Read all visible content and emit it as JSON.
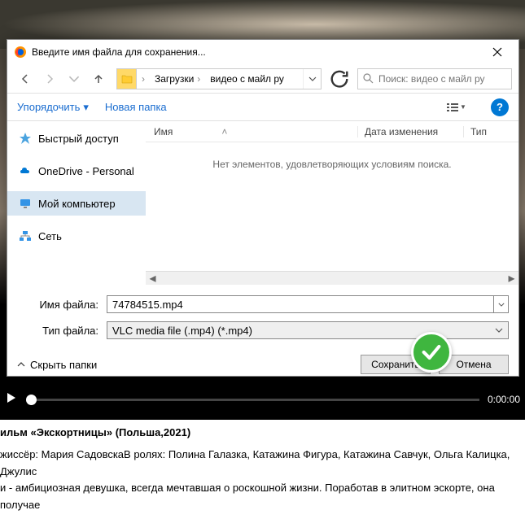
{
  "dialog": {
    "title": "Введите имя файла для сохранения...",
    "breadcrumb": {
      "seg1": "Загрузки",
      "seg2": "видео с майл ру"
    },
    "search_placeholder": "Поиск: видео с майл ру",
    "toolbar": {
      "organize": "Упорядочить",
      "new_folder": "Новая папка"
    },
    "sidebar": {
      "quick": "Быстрый доступ",
      "onedrive": "OneDrive - Personal",
      "computer": "Мой компьютер",
      "network": "Сеть"
    },
    "columns": {
      "name": "Имя",
      "date": "Дата изменения",
      "type": "Тип"
    },
    "empty_message": "Нет элементов, удовлетворяющих условиям поиска.",
    "form": {
      "filename_label": "Имя файла:",
      "filename_value": "74784515.mp4",
      "filetype_label": "Тип файла:",
      "filetype_value": "VLC media file (.mp4) (*.mp4)"
    },
    "hide_folders": "Скрыть папки",
    "buttons": {
      "save": "Сохранить",
      "cancel": "Отмена"
    }
  },
  "player": {
    "time": "0:00:00"
  },
  "page_text": {
    "title": "ильм «Экскортницы» (Польша,2021)",
    "line1": "жиссёр: Мария СадовскаВ ролях: Полина Галазка, Катажина Фигура, Катажина Савчук, Ольга Калицка, Джулис",
    "line2": "и - амбициозная девушка, всегда мечтавшая о роскошной жизни. Поработав в элитном эскорте, она получае"
  }
}
